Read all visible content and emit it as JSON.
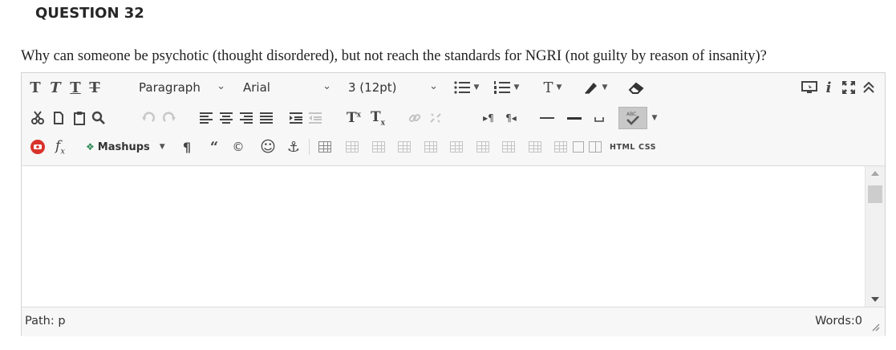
{
  "question": {
    "title": "QUESTION 32",
    "text": "Why can someone be psychotic (thought disordered), but not reach the standards for NGRI (not guilty by reason of insanity)?"
  },
  "toolbar": {
    "row1": {
      "format_select": "Paragraph",
      "font_select": "Arial",
      "size_select": "3 (12pt)"
    },
    "row3": {
      "mashups_label": "Mashups",
      "html_label": "HTML",
      "css_label": "CSS"
    }
  },
  "status": {
    "path": "Path: p",
    "words": "Words:0"
  },
  "colors": {
    "accent_red": "#d9322b",
    "icon_gray": "#4a4a4a",
    "toolbar_bg": "#f7f7f7",
    "spellcheck_bg": "#c8c8c8"
  }
}
